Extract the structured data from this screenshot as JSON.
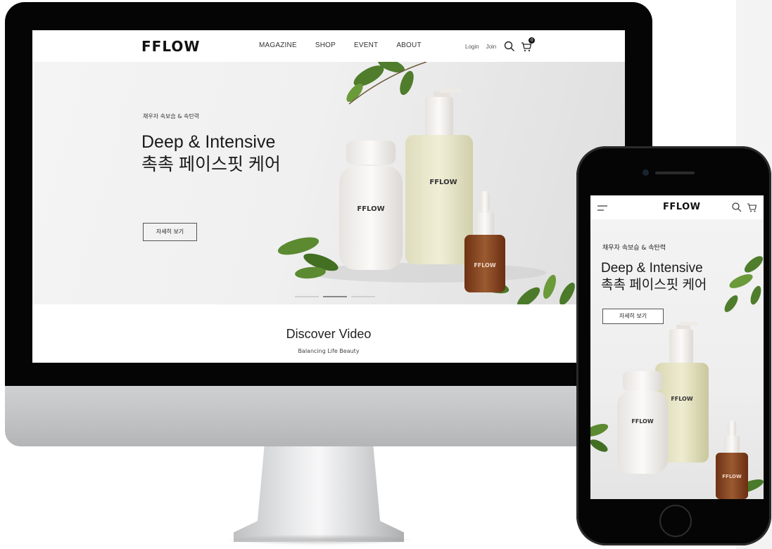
{
  "brand": {
    "logo": "FFLOW"
  },
  "desktop": {
    "nav": {
      "items": [
        "MAGAZINE",
        "SHOP",
        "EVENT",
        "ABOUT"
      ],
      "login": "Login",
      "join": "Join",
      "cart_count": "0"
    },
    "hero": {
      "kicker": "채우자 속보습 & 속탄력",
      "title_line1": "Deep & Intensive",
      "title_line2": "촉촉 페이스핏 케어",
      "button": "자세히 보기",
      "slides": 3,
      "active_slide": 2
    },
    "section": {
      "title": "Discover Video",
      "subtitle": "Balancing Life Beauty"
    }
  },
  "mobile": {
    "hero": {
      "kicker": "채우자 속보습 & 속탄력",
      "title_line1": "Deep & Intensive",
      "title_line2": "촉촉 페이스핏 케어",
      "button": "자세히 보기"
    }
  },
  "products": {
    "bottle_label": "FFLOW",
    "pump_label": "FFLOW",
    "dropper_label": "FFLOW"
  },
  "colors": {
    "bezel": "#050505",
    "hero_bg": "#f0f0f0",
    "text": "#1a1a1a",
    "leaf": "#4a7a2a",
    "amber": "#8a4a2a"
  }
}
